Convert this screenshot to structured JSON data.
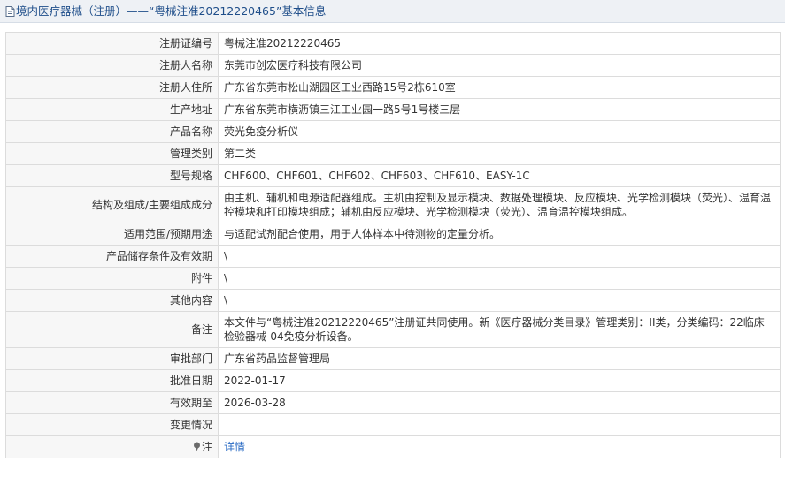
{
  "header": {
    "title": "境内医疗器械（注册）——“粤械注准20212220465”基本信息"
  },
  "rows": [
    {
      "label": "注册证编号",
      "value": "粤械注准20212220465"
    },
    {
      "label": "注册人名称",
      "value": "东莞市创宏医疗科技有限公司"
    },
    {
      "label": "注册人住所",
      "value": "广东省东莞市松山湖园区工业西路15号2栋610室"
    },
    {
      "label": "生产地址",
      "value": "广东省东莞市横沥镇三江工业园一路5号1号楼三层"
    },
    {
      "label": "产品名称",
      "value": "荧光免疫分析仪"
    },
    {
      "label": "管理类别",
      "value": "第二类"
    },
    {
      "label": "型号规格",
      "value": "CHF600、CHF601、CHF602、CHF603、CHF610、EASY-1C"
    },
    {
      "label": "结构及组成/主要组成成分",
      "value": "由主机、辅机和电源适配器组成。主机由控制及显示模块、数据处理模块、反应模块、光学检测模块（荧光）、温育温控模块和打印模块组成；辅机由反应模块、光学检测模块（荧光）、温育温控模块组成。"
    },
    {
      "label": "适用范围/预期用途",
      "value": "与适配试剂配合使用，用于人体样本中待测物的定量分析。"
    },
    {
      "label": "产品储存条件及有效期",
      "value": "\\"
    },
    {
      "label": "附件",
      "value": "\\"
    },
    {
      "label": "其他内容",
      "value": "\\"
    },
    {
      "label": "备注",
      "value": "本文件与“粤械注准20212220465”注册证共同使用。新《医疗器械分类目录》管理类别：II类，分类编码：22临床检验器械-04免疫分析设备。"
    },
    {
      "label": "审批部门",
      "value": "广东省药品监督管理局"
    },
    {
      "label": "批准日期",
      "value": "2022-01-17"
    },
    {
      "label": "有效期至",
      "value": "2026-03-28"
    },
    {
      "label": "变更情况",
      "value": ""
    }
  ],
  "note": {
    "label": "注",
    "link_text": "详情"
  }
}
